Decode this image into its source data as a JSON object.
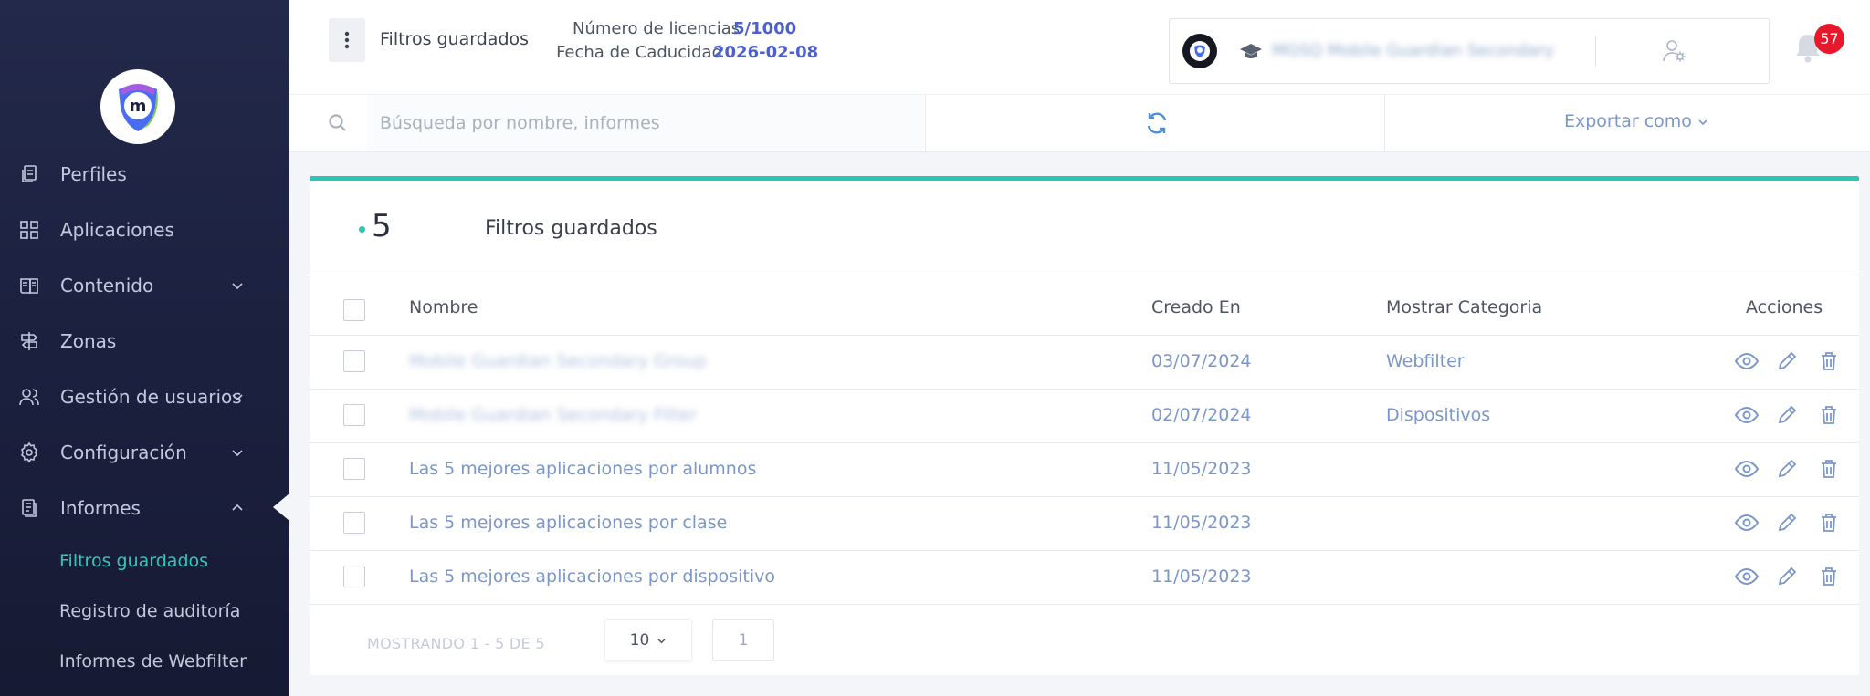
{
  "sidebar": {
    "items": [
      {
        "label": "Perfiles",
        "icon": "document-copy-icon"
      },
      {
        "label": "Aplicaciones",
        "icon": "grid-icon"
      },
      {
        "label": "Contenido",
        "icon": "book-icon"
      },
      {
        "label": "Zonas",
        "icon": "signpost-icon"
      },
      {
        "label": "Gestión de usuarios",
        "icon": "users-icon"
      },
      {
        "label": "Configuración",
        "icon": "gear-icon"
      },
      {
        "label": "Informes",
        "icon": "report-icon"
      }
    ],
    "subitems": [
      {
        "label": "Filtros guardados",
        "active": true
      },
      {
        "label": "Registro de auditoría"
      },
      {
        "label": "Informes de Webfilter"
      }
    ]
  },
  "header": {
    "title": "Filtros guardados",
    "license_label": "Número de licencias",
    "license_value": "5/1000",
    "expiry_label": "Fecha de Caducidad",
    "expiry_value": "2026-02-08",
    "account_name": "MGSQ Mobile Guardian Secondary",
    "notifications": "57"
  },
  "toolbar": {
    "search_placeholder": "Búsqueda por nombre, informes",
    "export_label": "Exportar como"
  },
  "card": {
    "count": "5",
    "title": "Filtros guardados",
    "columns": [
      "Nombre",
      "Creado En",
      "Mostrar Categoria",
      "Acciones"
    ],
    "rows": [
      {
        "name": "Mobile Guardian Secondary Group",
        "created": "03/07/2024",
        "category": "Webfilter"
      },
      {
        "name": "Mobile Guardian Secondary Filter",
        "created": "02/07/2024",
        "category": "Dispositivos"
      },
      {
        "name": "Las 5 mejores aplicaciones por alumnos",
        "created": "11/05/2023",
        "category": ""
      },
      {
        "name": "Las 5 mejores aplicaciones por clase",
        "created": "11/05/2023",
        "category": ""
      },
      {
        "name": "Las 5 mejores aplicaciones por dispositivo",
        "created": "11/05/2023",
        "category": ""
      }
    ]
  },
  "pagination": {
    "showing": "MOSTRANDO 1 - 5 DE 5",
    "page_size": "10",
    "page": "1"
  },
  "colors": {
    "accent": "#2ec4b6",
    "link": "#7b97c9",
    "highlight": "#4b5fd1",
    "badge": "#e8182c",
    "sidebar_bg": "#1c2140"
  }
}
